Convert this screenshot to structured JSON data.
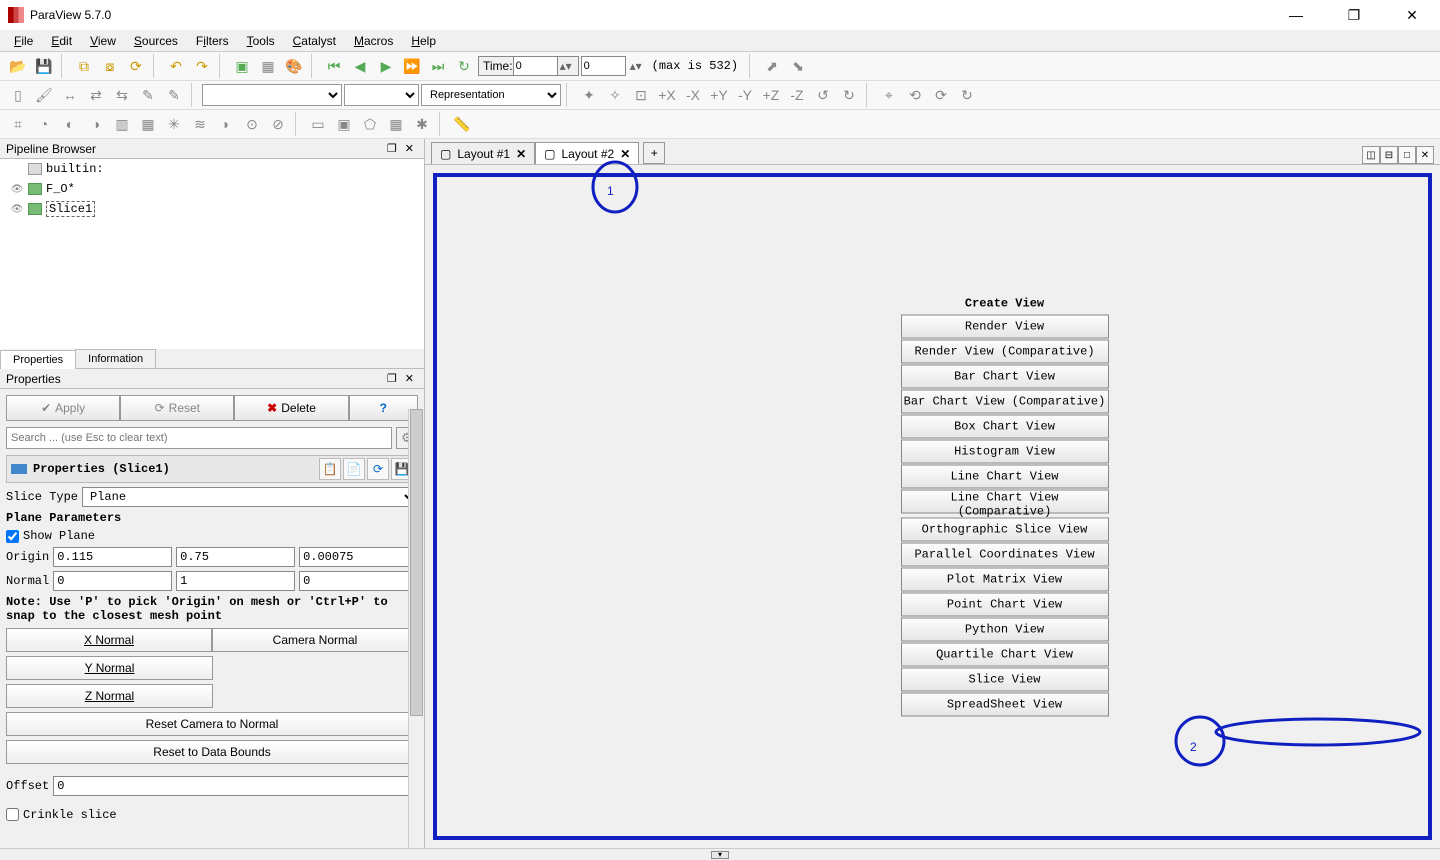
{
  "window": {
    "title": "ParaView 5.7.0"
  },
  "menus": [
    "File",
    "Edit",
    "View",
    "Sources",
    "Filters",
    "Tools",
    "Catalyst",
    "Macros",
    "Help"
  ],
  "time": {
    "label": "Time:",
    "value": "0",
    "frame": "0",
    "max_text": "(max is 532)"
  },
  "representation": {
    "placeholder": "Representation"
  },
  "pipeline": {
    "title": "Pipeline Browser",
    "nodes": [
      {
        "label": "builtin:",
        "icon": "server",
        "level": 1
      },
      {
        "label": "F_O*",
        "icon": "cube",
        "level": 2,
        "eye": true
      },
      {
        "label": "Slice1",
        "icon": "cube",
        "level": 2,
        "eye": true,
        "selected": true
      }
    ]
  },
  "prop_tabs": {
    "tab1": "Properties",
    "tab2": "Information"
  },
  "properties": {
    "panel_title": "Properties",
    "apply": "Apply",
    "reset": "Reset",
    "delete": "Delete",
    "help": "?",
    "search_placeholder": "Search ... (use Esc to clear text)",
    "section_title": "Properties (Slice1)",
    "slice_type_label": "Slice Type",
    "slice_type_value": "Plane",
    "plane_params": "Plane Parameters",
    "show_plane": "Show Plane",
    "origin_label": "Origin",
    "origin": [
      "0.115",
      "0.75",
      "0.00075"
    ],
    "normal_label": "Normal",
    "normal": [
      "0",
      "1",
      "0"
    ],
    "note": "Note: Use 'P' to pick 'Origin' on mesh or 'Ctrl+P' to snap to the closest mesh point",
    "x_norm": "X Normal",
    "y_norm": "Y Normal",
    "z_norm": "Z Normal",
    "cam_norm": "Camera Normal",
    "reset_cam": "Reset Camera to Normal",
    "reset_bounds": "Reset to Data Bounds",
    "offset_label": "Offset",
    "offset_value": "0",
    "crinkle": "Crinkle slice"
  },
  "layouts": {
    "tab1": "Layout #1",
    "tab2": "Layout #2",
    "add": "+"
  },
  "create_view": {
    "title": "Create View",
    "options": [
      "Render View",
      "Render View (Comparative)",
      "Bar Chart View",
      "Bar Chart View (Comparative)",
      "Box Chart View",
      "Histogram View",
      "Line Chart View",
      "Line Chart View (Comparative)",
      "Orthographic Slice View",
      "Parallel Coordinates View",
      "Plot Matrix View",
      "Point Chart View",
      "Python View",
      "Quartile Chart View",
      "Slice View",
      "SpreadSheet View"
    ]
  },
  "annotations": {
    "num1": "1",
    "num2": "2"
  }
}
